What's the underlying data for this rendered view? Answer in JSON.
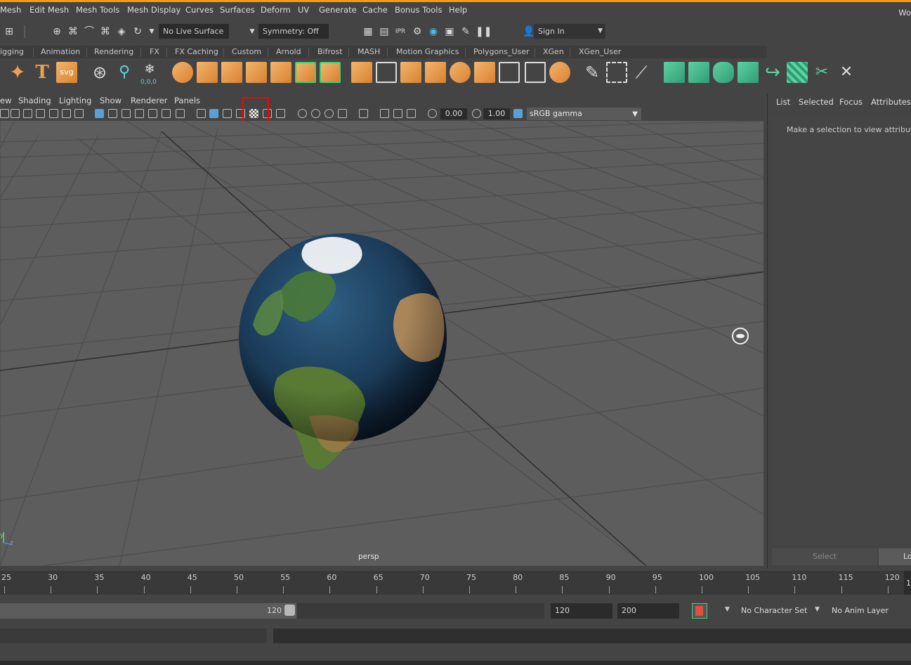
{
  "app": {
    "workspace_label": "Wo"
  },
  "menubar": [
    "Mesh",
    "Edit Mesh",
    "Mesh Tools",
    "Mesh Display",
    "Curves",
    "Surfaces",
    "Deform",
    "UV",
    "Generate",
    "Cache",
    "Bonus Tools",
    "Help"
  ],
  "statusline": {
    "live_surface": "No Live Surface",
    "symmetry": "Symmetry: Off",
    "sign_in": "Sign In"
  },
  "shelf_tabs": [
    "igging",
    "Animation",
    "Rendering",
    "FX",
    "FX Caching",
    "Custom",
    "Arnold",
    "Bifrost",
    "MASH",
    "Motion Graphics",
    "Polygons_User",
    "XGen",
    "XGen_User"
  ],
  "shelf_text_icons": {
    "svg": "svg",
    "coords": "0,0,0"
  },
  "panel_menu": [
    "ew",
    "Shading",
    "Lighting",
    "Show",
    "Renderer",
    "Panels"
  ],
  "panel_toolbar": {
    "exposure": "0.00",
    "gamma_value": "1.00",
    "color_space": "sRGB gamma",
    "highlighted_tool": "texture-checker-icon"
  },
  "viewport": {
    "camera": "persp",
    "axis_y": "y",
    "axis_z": "z"
  },
  "attribute_editor": {
    "tabs": [
      "List",
      "Selected",
      "Focus",
      "Attributes"
    ],
    "message": "Make a selection to view attributes",
    "select_button": "Select",
    "load_button": "Lo"
  },
  "timeline": {
    "ticks": [
      "25",
      "30",
      "35",
      "40",
      "45",
      "50",
      "55",
      "60",
      "65",
      "70",
      "75",
      "80",
      "85",
      "90",
      "95",
      "100",
      "105",
      "110",
      "115",
      "120"
    ],
    "current_frame": "1"
  },
  "range": {
    "range_end": "120",
    "anim_end": "120",
    "playback_end": "200",
    "character_set": "No Character Set",
    "anim_layer": "No Anim Layer"
  }
}
